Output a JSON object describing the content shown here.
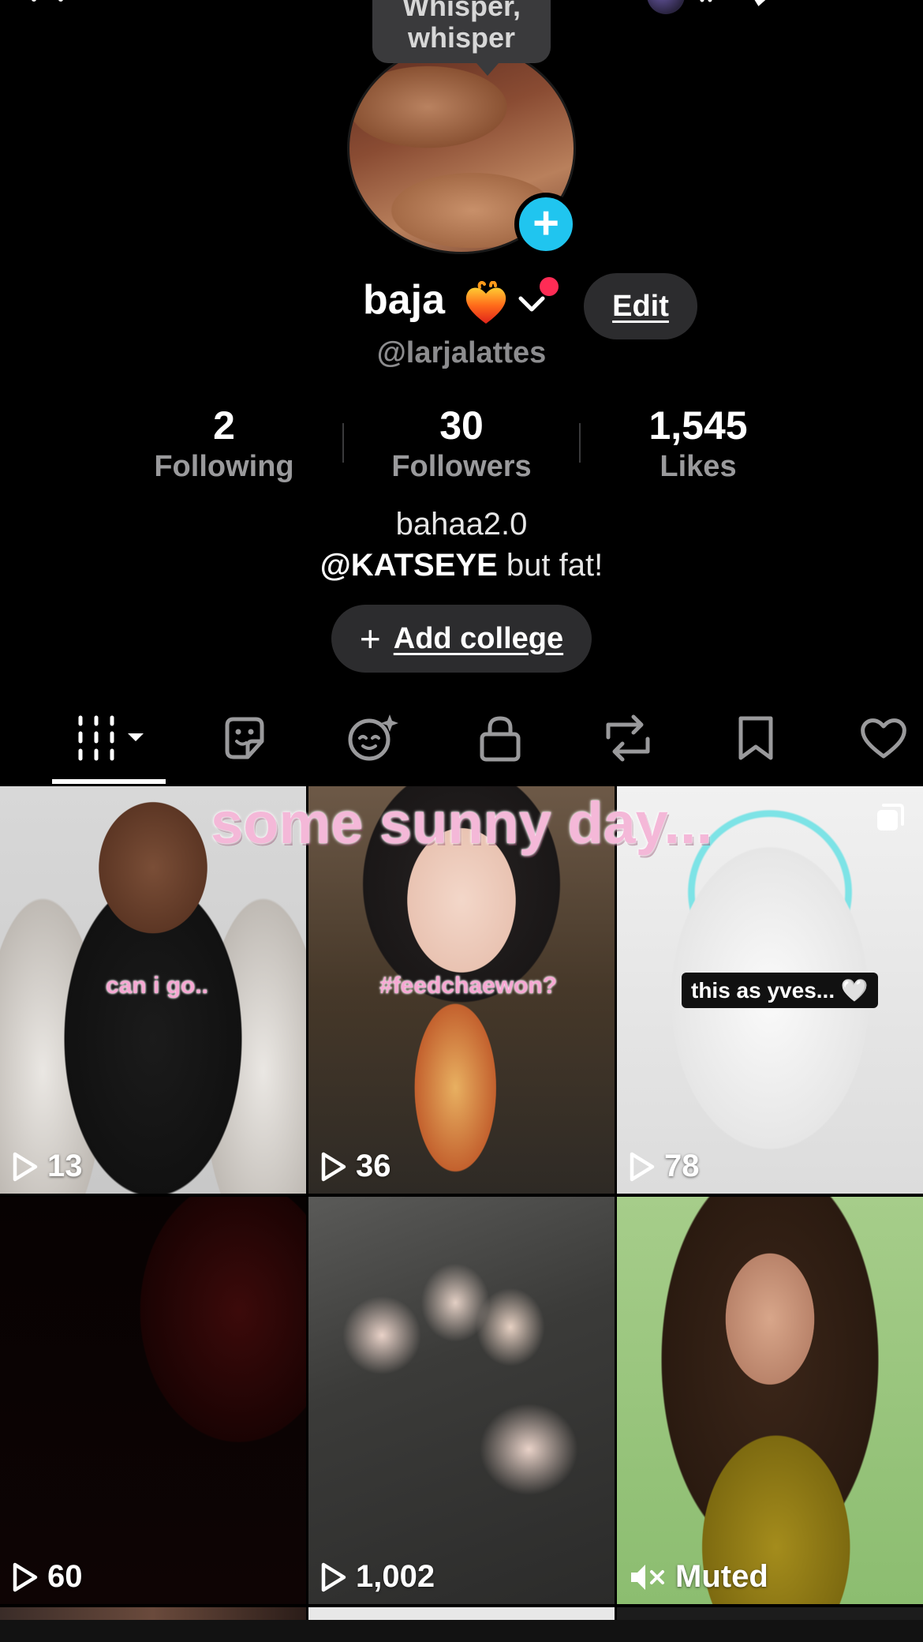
{
  "tooltip": {
    "line1": "Whisper,",
    "line2": "whisper"
  },
  "profile": {
    "name": "baja",
    "handle": "@larjalattes",
    "edit_label": "Edit",
    "stats": [
      {
        "value": "2",
        "label": "Following"
      },
      {
        "value": "30",
        "label": "Followers"
      },
      {
        "value": "1,545",
        "label": "Likes"
      }
    ],
    "bio_line1": "bahaa2.0",
    "bio_mention": "@KATSEYE",
    "bio_rest": " but fat!",
    "add_college_label": "Add college",
    "add_college_plus": "+",
    "avatar_plus": "+"
  },
  "tabs": [
    {
      "icon": "videos-grid-icon",
      "active": true
    },
    {
      "icon": "sticker-icon",
      "active": false
    },
    {
      "icon": "ai-face-icon",
      "active": false
    },
    {
      "icon": "lock-icon",
      "active": false
    },
    {
      "icon": "repost-icon",
      "active": false
    },
    {
      "icon": "bookmark-icon",
      "active": false
    },
    {
      "icon": "heart-icon",
      "active": false
    }
  ],
  "grid": {
    "overlay_title": "some sunny day...",
    "videos": [
      {
        "views": "13",
        "caption": "can i go.."
      },
      {
        "views": "36",
        "caption": "#feedchaewon?"
      },
      {
        "views": "78",
        "caption": "this as yves... 🤍"
      },
      {
        "views": "60"
      },
      {
        "views": "1,002"
      },
      {
        "muted_label": "Muted"
      }
    ]
  },
  "colors": {
    "accent_cyan": "#20c5ef",
    "notification_red": "#fe2c55",
    "pill_bg": "#2c2c2e",
    "muted_text": "#9a9a9c"
  }
}
